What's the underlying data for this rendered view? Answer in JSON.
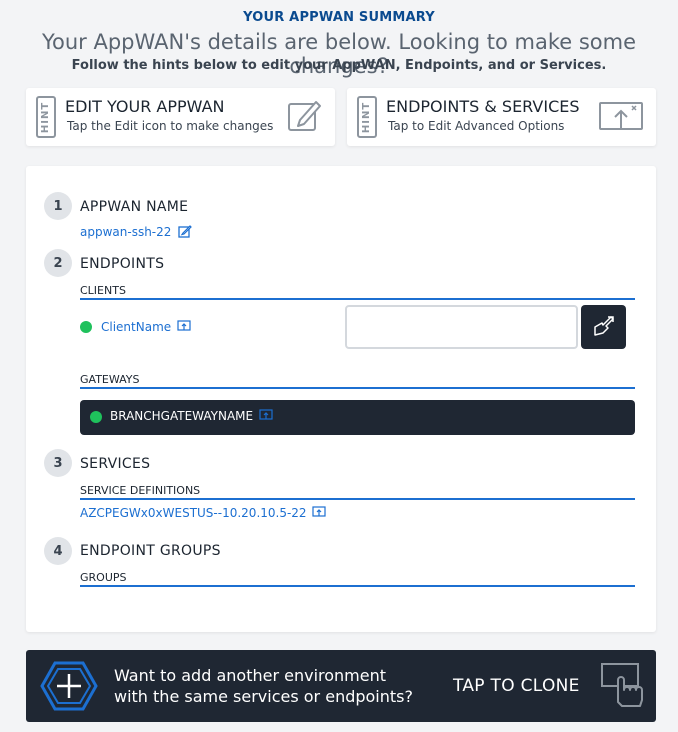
{
  "header": {
    "title": "YOUR APPWAN SUMMARY",
    "subtitle": "Your AppWAN's details are below. Looking to make some changes?",
    "hint": "Follow the hints below to edit your AppWAN, Endpoints, and or Services."
  },
  "hints": [
    {
      "badge": "HINT",
      "title": "EDIT YOUR APPWAN",
      "text": "Tap the Edit icon to make changes",
      "icon": "edit-icon"
    },
    {
      "badge": "HINT",
      "title": "ENDPOINTS & SERVICES",
      "text": "Tap to Edit Advanced Options",
      "icon": "open-window-icon"
    }
  ],
  "summary": {
    "appwan": {
      "number": "1",
      "title": "APPWAN NAME",
      "name": "appwan-ssh-22"
    },
    "endpoints": {
      "number": "2",
      "title": "ENDPOINTS",
      "clients_label": "CLIENTS",
      "client": {
        "name": "ClientName",
        "status_color": "#1fc15c"
      },
      "client_input": {
        "value": "",
        "placeholder": ""
      },
      "gateways_label": "GATEWAYS",
      "gateway": {
        "name": "BRANCHGATEWAYNAME",
        "status_color": "#1fc15c"
      }
    },
    "services": {
      "number": "3",
      "title": "SERVICES",
      "definitions_label": "SERVICE DEFINITIONS",
      "service": "AZCPEGWx0xWESTUS--10.20.10.5-22"
    },
    "endpoint_groups": {
      "number": "4",
      "title": "ENDPOINT GROUPS",
      "groups_label": "GROUPS"
    }
  },
  "clone": {
    "text": "Want to add another environment with the same services or endpoints?",
    "action": "TAP TO CLONE"
  },
  "colors": {
    "accent": "#1c6fd1",
    "dark": "#1f2733",
    "status_online": "#1fc15c",
    "title_blue": "#0a4a8f"
  }
}
